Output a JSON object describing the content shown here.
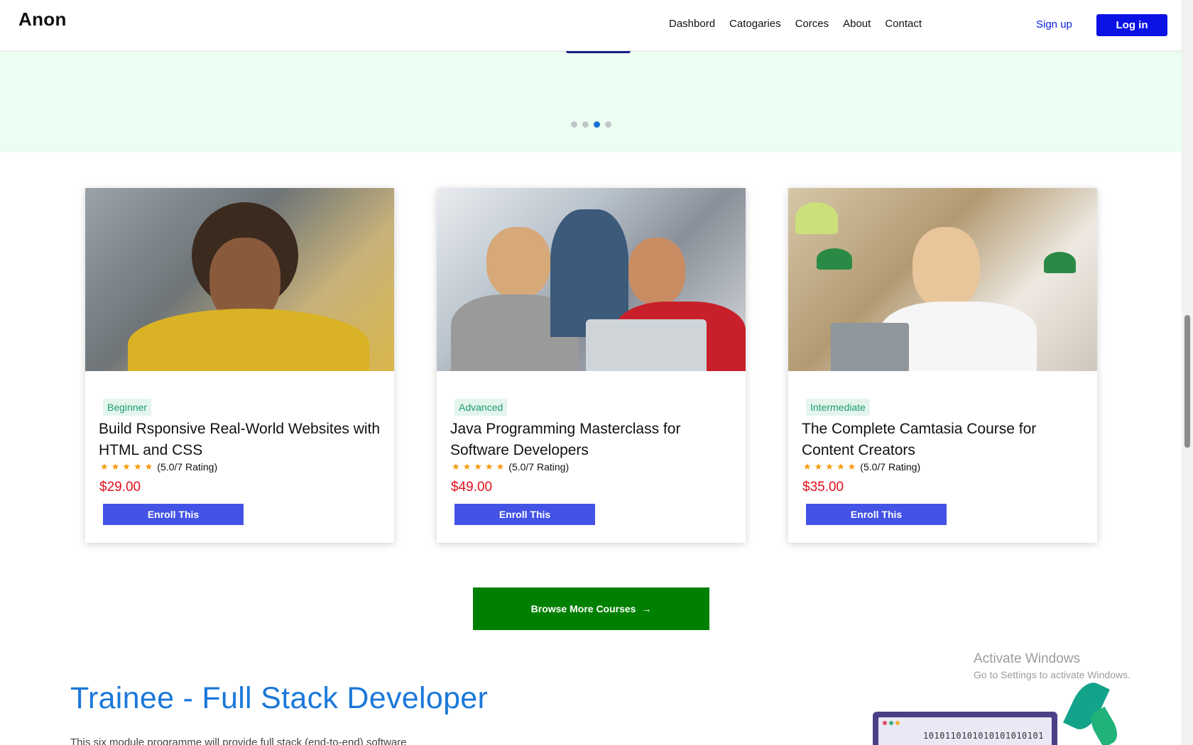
{
  "navbar": {
    "brand": "Anon",
    "links": [
      "Dashbord",
      "Catogaries",
      "Corces",
      "About",
      "Contact"
    ],
    "signup_label": "Sign up",
    "login_label": "Log in"
  },
  "carousel": {
    "dots_count": 4,
    "active_index": 2
  },
  "courses": [
    {
      "level": "Beginner",
      "title": "Build Rsponsive Real-World Websites with HTML and CSS",
      "rating_text": "(5.0/7 Rating)",
      "rating_stars": 5,
      "price": "$29.00",
      "enroll_label": "Enroll This"
    },
    {
      "level": "Advanced",
      "title": "Java Programming Masterclass for Software Developers",
      "rating_text": "(5.0/7 Rating)",
      "rating_stars": 5,
      "price": "$49.00",
      "enroll_label": "Enroll This"
    },
    {
      "level": "Intermediate",
      "title": "The Complete Camtasia Course for Content Creators",
      "rating_text": "(5.0/7 Rating)",
      "rating_stars": 5,
      "price": "$35.00",
      "enroll_label": "Enroll This"
    }
  ],
  "browse": {
    "label": "Browse More Courses",
    "arrow": "→"
  },
  "trainee": {
    "title": "Trainee - Full Stack Developer",
    "description": "This six module programme will provide full stack (end-to-end) software"
  },
  "watermark": {
    "title": "Activate Windows",
    "subtitle": "Go to Settings to activate Windows."
  },
  "illustration": {
    "binary": "1010110101010101010101"
  },
  "colors": {
    "primary": "#0a12e6",
    "enroll": "#4353e6",
    "browse": "#008000",
    "price": "#e0101a",
    "badge_text": "#1c9d6c",
    "hero_bg": "#ecfdf1",
    "trainee_title": "#1b78d9"
  }
}
